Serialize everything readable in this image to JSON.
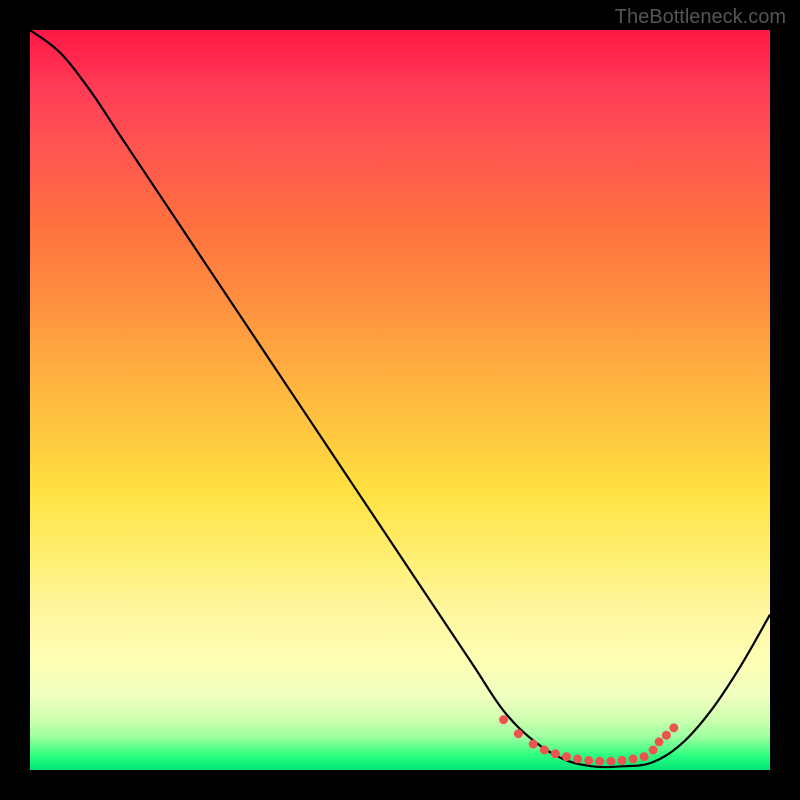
{
  "watermark": "TheBottleneck.com",
  "chart_data": {
    "type": "line",
    "title": "",
    "xlabel": "",
    "ylabel": "",
    "xlim": [
      0,
      100
    ],
    "ylim": [
      0,
      100
    ],
    "grid": false,
    "legend": false,
    "series": [
      {
        "name": "bottleneck-curve",
        "color": "#000000",
        "x": [
          0,
          4,
          8,
          12,
          16,
          20,
          24,
          28,
          32,
          36,
          40,
          44,
          48,
          52,
          56,
          60,
          64,
          68,
          72,
          76,
          80,
          84,
          88,
          92,
          96,
          100
        ],
        "y": [
          100,
          97,
          92,
          86,
          80,
          74,
          68,
          62,
          56,
          50,
          44,
          38,
          32,
          26,
          20,
          14,
          8,
          4,
          1.5,
          0.5,
          0.5,
          1,
          3.5,
          8,
          14,
          21
        ]
      }
    ],
    "markers": {
      "name": "optimal-range",
      "color": "#ef5350",
      "style": "dotted",
      "x": [
        64,
        66,
        68,
        69.5,
        71,
        72.5,
        74,
        75.5,
        77,
        78.5,
        80,
        81.5,
        83,
        84.2,
        85,
        86,
        87
      ],
      "y": [
        6.8,
        4.9,
        3.5,
        2.7,
        2.2,
        1.8,
        1.5,
        1.3,
        1.2,
        1.2,
        1.3,
        1.5,
        1.8,
        2.7,
        3.8,
        4.7,
        5.7
      ]
    },
    "background_gradient": {
      "type": "vertical",
      "stops": [
        {
          "pos": 0,
          "color": "#ff1744"
        },
        {
          "pos": 50,
          "color": "#ffc940"
        },
        {
          "pos": 85,
          "color": "#ffffb3"
        },
        {
          "pos": 100,
          "color": "#00e676"
        }
      ]
    }
  }
}
